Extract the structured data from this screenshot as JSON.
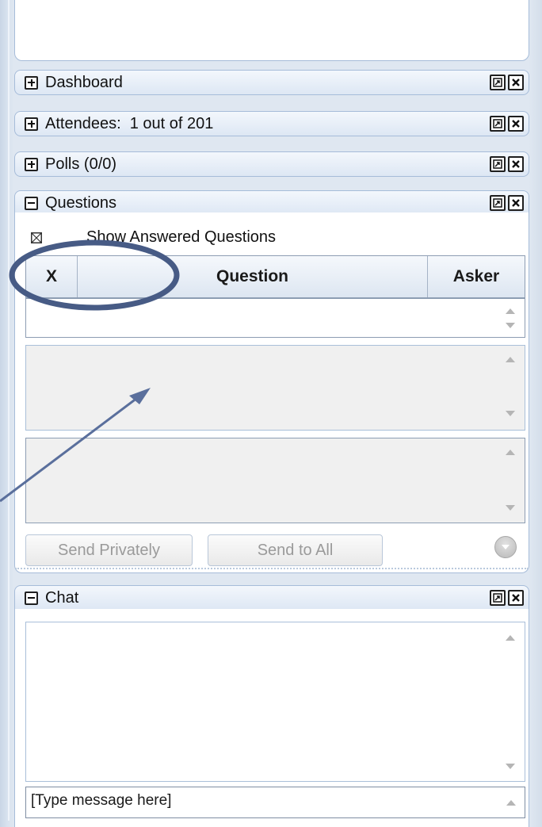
{
  "sections": {
    "dashboard": {
      "title": "Dashboard"
    },
    "attendees": {
      "title": "Attendees:  1 out of 201"
    },
    "polls": {
      "title": "Polls (0/0)"
    },
    "questions": {
      "title": "Questions"
    },
    "chat": {
      "title": "Chat"
    }
  },
  "questions": {
    "show_answered_label": "Show Answered Questions",
    "show_answered_checked": false,
    "columns": [
      "X",
      "Question",
      "Asker"
    ],
    "send_privately_label": "Send Privately",
    "send_to_all_label": "Send to All"
  },
  "chat": {
    "input_value": "[Type message here]"
  },
  "colors": {
    "accent_border": "#a6bcd9",
    "annotation": "#4a5f8c",
    "disabled_text": "#9a9a9a"
  },
  "icons": {
    "expand": "plus-box-icon",
    "collapse": "minus-box-icon",
    "popout": "popout-icon",
    "close": "close-icon",
    "scroll_up": "scroll-up-arrow-icon",
    "scroll_down": "scroll-down-arrow-icon"
  }
}
